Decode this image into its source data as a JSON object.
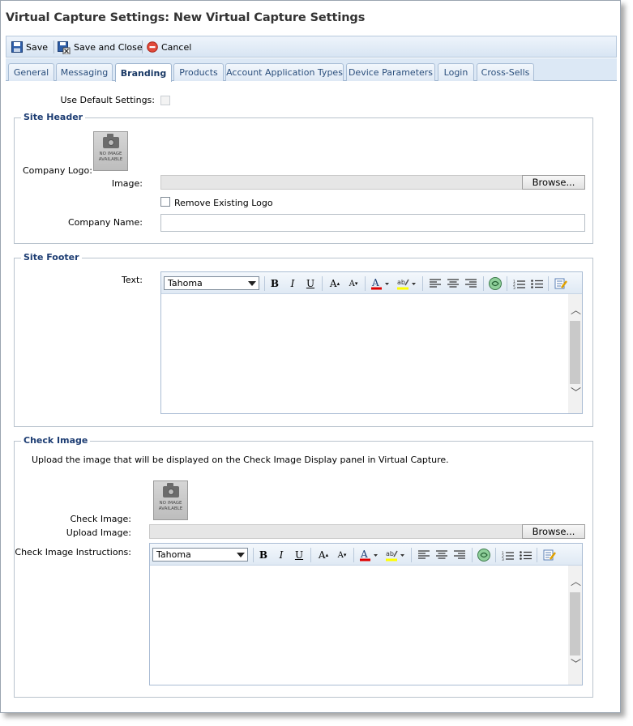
{
  "window": {
    "title": "Virtual Capture Settings: New Virtual Capture Settings"
  },
  "toolbar": {
    "save": "Save",
    "save_close": "Save and Close",
    "cancel": "Cancel"
  },
  "tabs": [
    "General",
    "Messaging",
    "Branding",
    "Products",
    "Account Application Types",
    "Device Parameters",
    "Login",
    "Cross-Sells"
  ],
  "active_tab": "Branding",
  "use_default": {
    "label": "Use Default Settings:",
    "checked": false,
    "disabled": true
  },
  "site_header": {
    "legend": "Site Header",
    "company_logo_label": "Company Logo:",
    "no_image_text": "NO IMAGE AVAILABLE",
    "image_label": "Image:",
    "browse": "Browse...",
    "remove_logo_label": "Remove Existing Logo",
    "company_name_label": "Company Name:",
    "company_name_value": ""
  },
  "site_footer": {
    "legend": "Site Footer",
    "text_label": "Text:",
    "font": "Tahoma"
  },
  "check_image": {
    "legend": "Check Image",
    "description": "Upload the image that will be displayed on the Check Image Display panel in Virtual Capture.",
    "check_image_label": "Check Image:",
    "no_image_text": "NO IMAGE AVAILABLE",
    "upload_label": "Upload Image:",
    "browse": "Browse...",
    "instructions_label": "Check Image Instructions:",
    "font": "Tahoma"
  },
  "colors": {
    "tab_active_text": "#1b3a66",
    "legend": "#1d3d73",
    "font_color_bar": "#e00000",
    "highlight_bar": "#ffff00"
  }
}
